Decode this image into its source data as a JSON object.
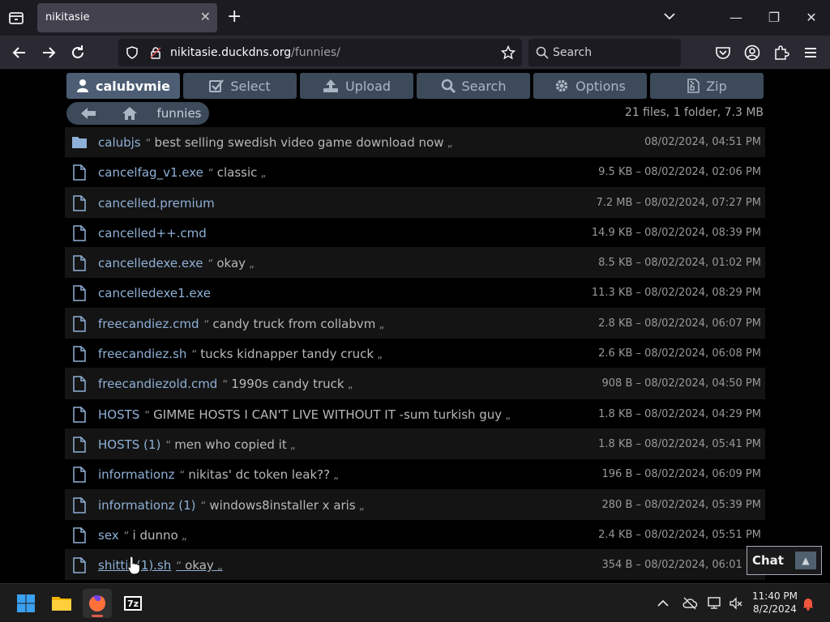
{
  "browser": {
    "tab_title": "nikitasie",
    "url_host": "nikitasie.duckdns.org",
    "url_path": "/funnies/",
    "search_placeholder": "Search"
  },
  "toolbar": {
    "user": "calubvmie",
    "select": "Select",
    "upload": "Upload",
    "search": "Search",
    "options": "Options",
    "zip": "Zip"
  },
  "breadcrumb": {
    "folder": "funnies"
  },
  "summary": "21 files, 1 folder, 7.3 MB",
  "files": [
    {
      "name": "calubjs",
      "comment": "best selling swedish video game download now",
      "meta": "08/02/2024, 04:51 PM",
      "type": "folder"
    },
    {
      "name": "cancelfag_v1.exe",
      "comment": "classic",
      "meta": "9.5 KB – 08/02/2024, 02:06 PM",
      "type": "file"
    },
    {
      "name": "cancelled.premium",
      "comment": "",
      "meta": "7.2 MB – 08/02/2024, 07:27 PM",
      "type": "file"
    },
    {
      "name": "cancelled++.cmd",
      "comment": "",
      "meta": "14.9 KB – 08/02/2024, 08:39 PM",
      "type": "file"
    },
    {
      "name": "cancelledexe.exe",
      "comment": "okay",
      "meta": "8.5 KB – 08/02/2024, 01:02 PM",
      "type": "file"
    },
    {
      "name": "cancelledexe1.exe",
      "comment": "",
      "meta": "11.3 KB – 08/02/2024, 08:29 PM",
      "type": "file"
    },
    {
      "name": "freecandiez.cmd",
      "comment": "candy truck from collabvm",
      "meta": "2.8 KB – 08/02/2024, 06:07 PM",
      "type": "file"
    },
    {
      "name": "freecandiez.sh",
      "comment": "tucks kidnapper tandy cruck",
      "meta": "2.6 KB – 08/02/2024, 06:08 PM",
      "type": "file"
    },
    {
      "name": "freecandiezold.cmd",
      "comment": "1990s candy truck",
      "meta": "908 B – 08/02/2024, 04:50 PM",
      "type": "file"
    },
    {
      "name": "HOSTS",
      "comment": "GIMME HOSTS I CAN'T LIVE WITHOUT IT -sum turkish guy",
      "meta": "1.8 KB – 08/02/2024, 04:29 PM",
      "type": "file"
    },
    {
      "name": "HOSTS (1)",
      "comment": "men who copied it",
      "meta": "1.8 KB – 08/02/2024, 05:41 PM",
      "type": "file"
    },
    {
      "name": "informationz",
      "comment": "nikitas' dc token leak??",
      "meta": "196 B – 08/02/2024, 06:09 PM",
      "type": "file"
    },
    {
      "name": "informationz (1)",
      "comment": "windows8installer x aris",
      "meta": "280 B – 08/02/2024, 05:39 PM",
      "type": "file"
    },
    {
      "name": "sex",
      "comment": "i dunno",
      "meta": "2.4 KB – 08/02/2024, 05:51 PM",
      "type": "file"
    },
    {
      "name": "shittin(1).sh",
      "comment": "okay",
      "meta": "354 B – 08/02/2024, 06:01 PM",
      "type": "file"
    }
  ],
  "chat": {
    "label": "Chat",
    "toggle": "▲"
  },
  "taskbar": {
    "time": "11:40 PM",
    "date": "8/2/2024"
  },
  "colors": {
    "accent": "#3c4a5a",
    "link": "#8fb0d6"
  }
}
